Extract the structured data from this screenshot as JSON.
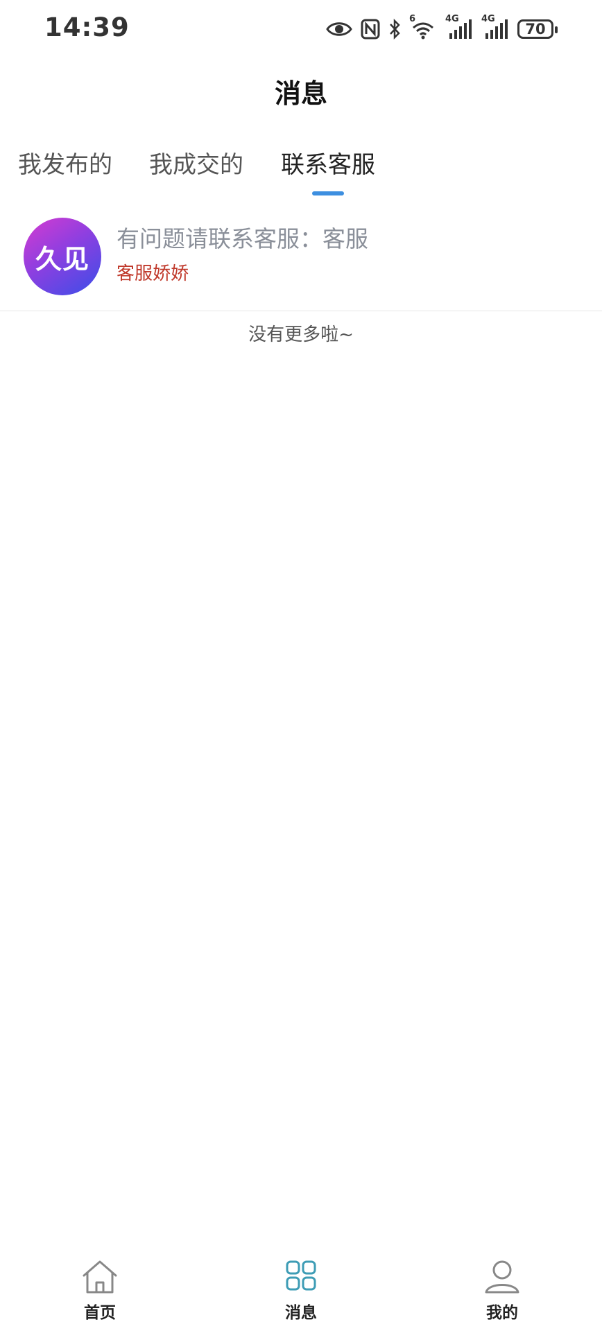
{
  "status_bar": {
    "time": "14:39",
    "wifi_label": "6",
    "signal1_label": "4G",
    "signal2_label": "4G",
    "battery": "70",
    "icons": [
      "eye-icon",
      "nfc-icon",
      "bluetooth-icon",
      "wifi-icon",
      "signal-icon",
      "signal-icon",
      "battery-icon"
    ]
  },
  "header": {
    "title": "消息"
  },
  "tabs": [
    {
      "label": "我发布的",
      "active": false
    },
    {
      "label": "我成交的",
      "active": false
    },
    {
      "label": "联系客服",
      "active": true
    }
  ],
  "messages": [
    {
      "avatar_text": "久见",
      "title": "有问题请联系客服：客服",
      "subtitle": "客服娇娇"
    }
  ],
  "list_footer": "没有更多啦~",
  "bottom_nav": [
    {
      "label": "首页",
      "icon": "home-icon"
    },
    {
      "label": "消息",
      "icon": "grid-icon"
    },
    {
      "label": "我的",
      "icon": "user-icon"
    }
  ],
  "colors": {
    "accent": "#3d8fe0",
    "subtitle_red": "#c0392b",
    "nav_active": "#3d9cb5"
  }
}
